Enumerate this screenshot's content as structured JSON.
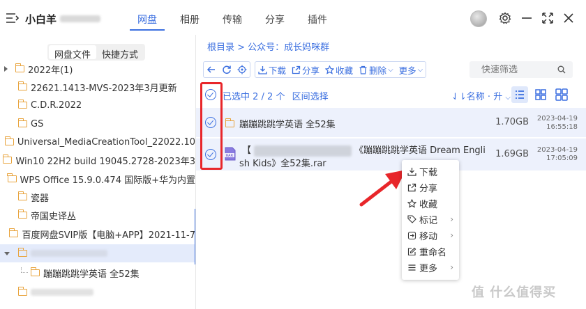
{
  "header": {
    "username": "小白羊",
    "tabs": [
      {
        "label": "网盘",
        "active": true
      },
      {
        "label": "相册"
      },
      {
        "label": "传输"
      },
      {
        "label": "分享"
      },
      {
        "label": "插件"
      }
    ],
    "accent_color": "#3b6fe0"
  },
  "sidebar": {
    "tabs": [
      "网盘文件",
      "快捷方式"
    ],
    "items": [
      {
        "label": "2022年(1)"
      },
      {
        "label": "22621.1413-MVS-2023年3月更新"
      },
      {
        "label": "C.D.R.2022"
      },
      {
        "label": "GS"
      },
      {
        "label": "Universal_MediaCreationTool_22022.10"
      },
      {
        "label": "Win10 22H2 build 19045.2728-2023年3"
      },
      {
        "label": "WPS Office 15.9.0.474 国际版+华为内置"
      },
      {
        "label": "瓷器"
      },
      {
        "label": "帝国史译丛"
      },
      {
        "label": "百度网盘SVIP版【电脑+APP】2021-11-7"
      },
      {
        "label": ""
      },
      {
        "label": "蹦蹦跳跳学英语 全52集"
      },
      {
        "label": ""
      }
    ]
  },
  "main": {
    "breadcrumb": "根目录 > 公众号：成长妈咪群",
    "toolbar": {
      "download": "下载",
      "share": "分享",
      "favorite": "收藏",
      "delete": "删除",
      "more": "更多",
      "filter_placeholder": "快速筛选"
    },
    "selection_text": "已选中 2 / 2 个",
    "range_select": "区间选择",
    "sort_label": "名称 · 升",
    "files": [
      {
        "name": "蹦蹦跳跳学英语 全52集",
        "size": "1.70GB",
        "date": "2023-04-19",
        "time": "16:55:18"
      },
      {
        "name_line1": "【",
        "name_line1b": "《蹦蹦跳跳学英语 Dream Engli",
        "name_line2": "sh Kids》全52集.rar",
        "size": "1.69GB",
        "date": "2023-04-19",
        "time": "17:05:09"
      }
    ]
  },
  "context_menu": {
    "items": [
      "下载",
      "分享",
      "收藏",
      "标记",
      "移动",
      "重命名",
      "更多"
    ]
  },
  "watermark": "值 什么值得买",
  "highlight_color": "#e8262a"
}
